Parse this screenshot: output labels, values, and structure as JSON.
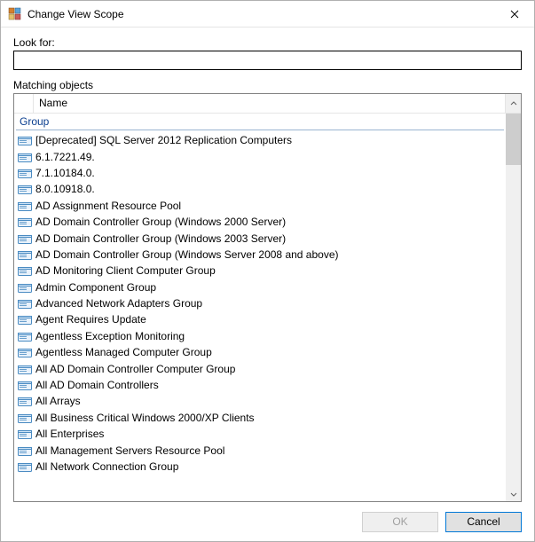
{
  "titlebar": {
    "title": "Change View Scope"
  },
  "labels": {
    "look_for": "Look for:",
    "matching_objects": "Matching objects"
  },
  "search": {
    "value": "",
    "placeholder": ""
  },
  "list": {
    "column_header": "Name",
    "group_header": "Group",
    "items": [
      "[Deprecated] SQL Server 2012 Replication Computers",
      "6.1.7221.49.",
      "7.1.10184.0.",
      "8.0.10918.0.",
      "AD Assignment Resource Pool",
      "AD Domain Controller Group (Windows 2000 Server)",
      "AD Domain Controller Group (Windows 2003 Server)",
      "AD Domain Controller Group (Windows Server 2008 and above)",
      "AD Monitoring Client Computer Group",
      "Admin Component Group",
      "Advanced Network Adapters Group",
      "Agent Requires Update",
      "Agentless Exception Monitoring",
      "Agentless Managed Computer Group",
      "All AD Domain Controller Computer Group",
      "All AD Domain Controllers",
      "All Arrays",
      "All Business Critical Windows 2000/XP Clients",
      "All Enterprises",
      "All Management Servers Resource Pool",
      "All Network Connection Group"
    ]
  },
  "buttons": {
    "ok": "OK",
    "cancel": "Cancel"
  }
}
